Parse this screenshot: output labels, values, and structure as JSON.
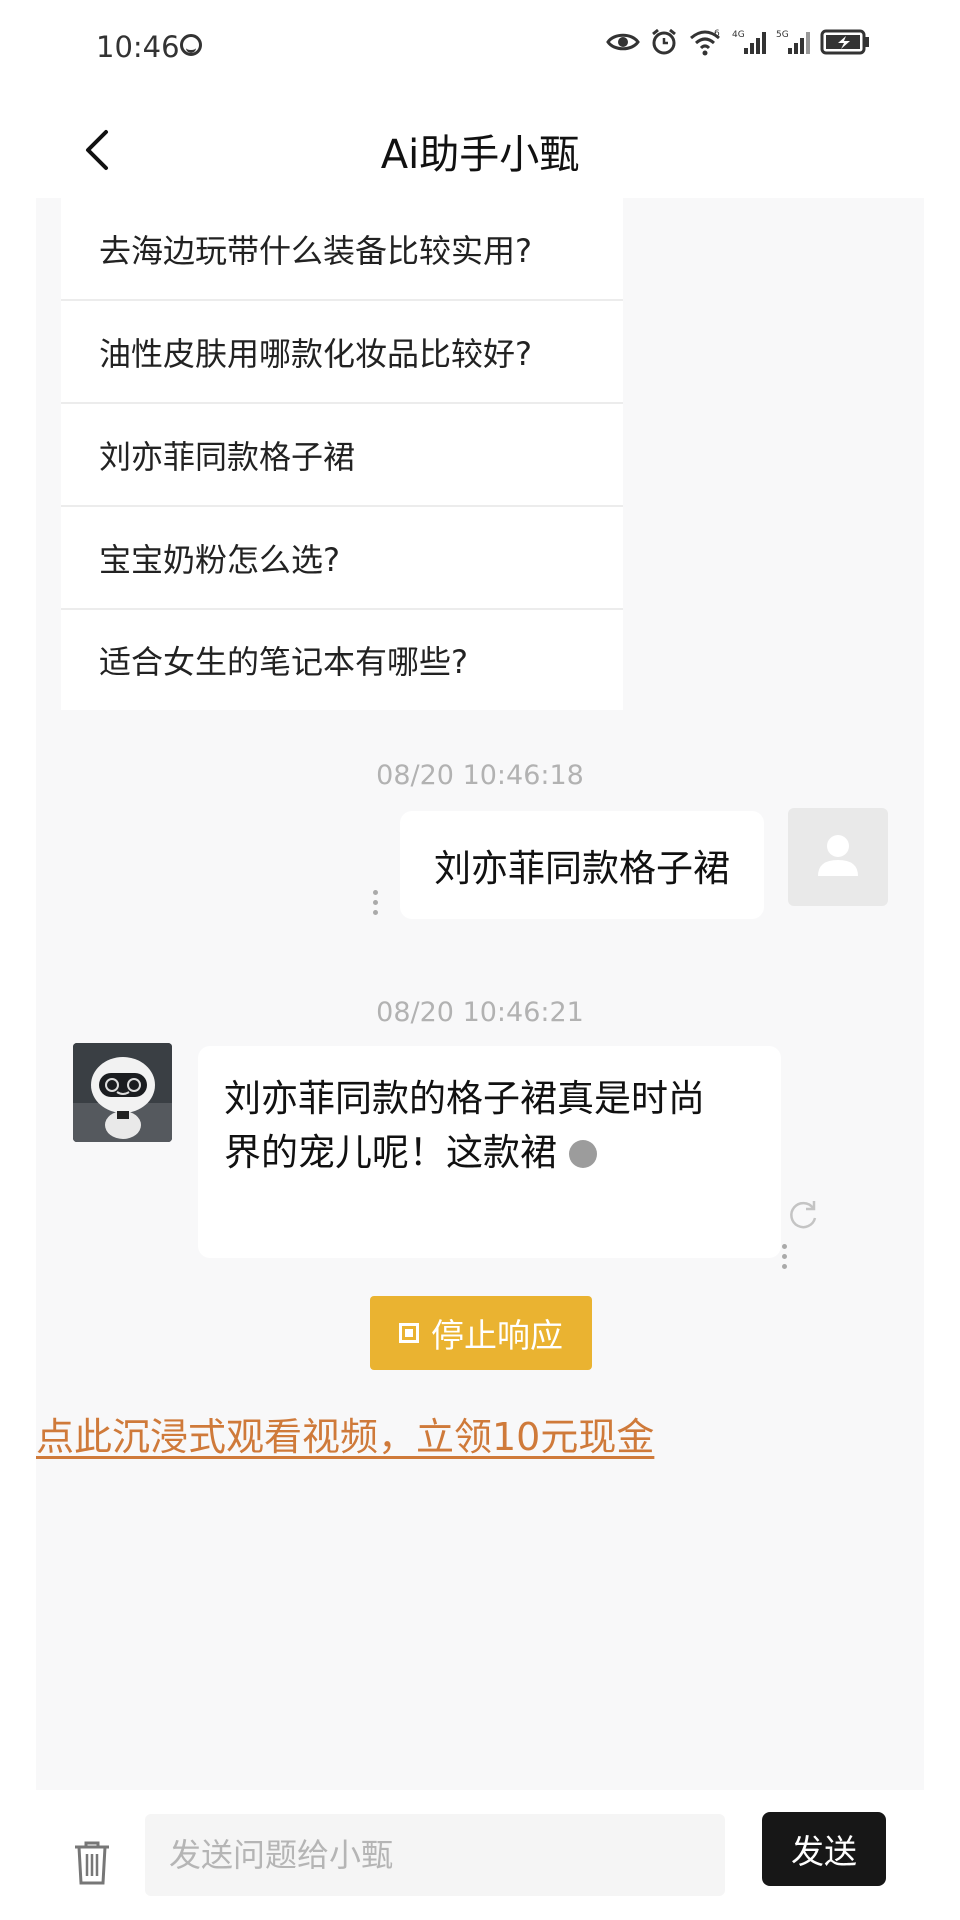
{
  "status_bar": {
    "time": "10:46",
    "icons": [
      "face-icon",
      "eye-icon",
      "alarm-icon",
      "wifi-icon",
      "signal-4g-icon",
      "signal-5g-icon",
      "battery-icon"
    ],
    "network_labels": [
      "6",
      "4G",
      "5G"
    ]
  },
  "header": {
    "title": "Ai助手小甄",
    "back_icon": "chevron-left-icon"
  },
  "suggestions": [
    "去海边玩带什么装备比较实用?",
    "油性皮肤用哪款化妆品比较好?",
    "刘亦菲同款格子裙",
    "宝宝奶粉怎么选?",
    "适合女生的笔记本有哪些?"
  ],
  "messages": [
    {
      "timestamp": "08/20 10:46:18",
      "sender": "user",
      "text": "刘亦菲同款格子裙"
    },
    {
      "timestamp": "08/20 10:46:21",
      "sender": "bot",
      "text_line1": "刘亦菲同款的格子裙真是时尚",
      "text_line2": "界的宠儿呢！这款裙"
    }
  ],
  "stop_button": {
    "label": "停止响应"
  },
  "promo": {
    "text": "点此沉浸式观看视频，立领10元现金"
  },
  "input_bar": {
    "placeholder": "发送问题给小甄",
    "value": "",
    "send_label": "发送"
  },
  "colors": {
    "accent_yellow": "#eab331",
    "promo_orange": "#cf7a3a",
    "send_black": "#171717",
    "chat_bg": "#f8f8f9"
  }
}
